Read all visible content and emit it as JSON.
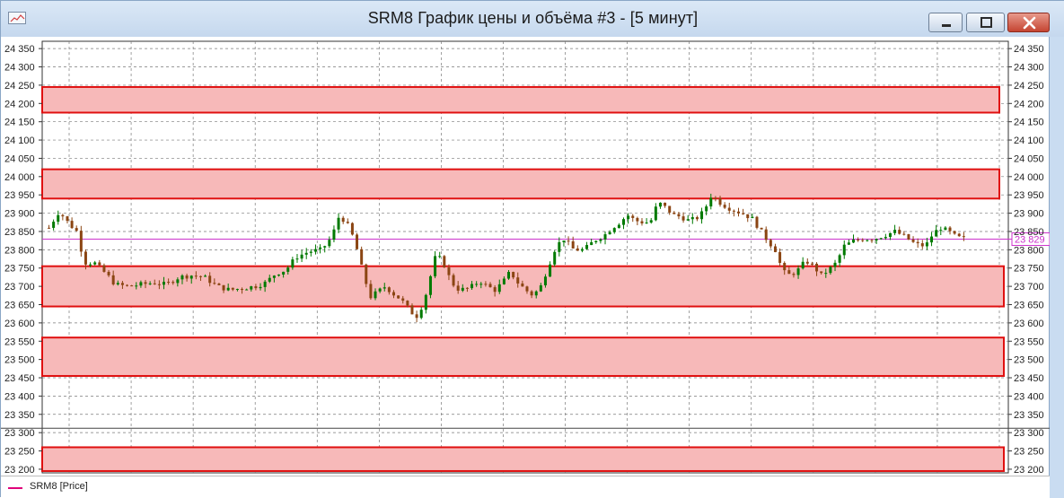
{
  "window": {
    "title": "SRM8 График цены и объёма #3 - [5 минут]",
    "controls": [
      "minimize",
      "maximize",
      "close"
    ]
  },
  "legend": {
    "label": "SRM8 [Price]",
    "color": "#e0007a"
  },
  "colors": {
    "up_candle": "#007a00",
    "down_candle": "#8b4513",
    "zone_fill": "#f7b9b9",
    "zone_border": "#e01010",
    "last_price_line": "#cc33cc",
    "grid": "#7a7a7a"
  },
  "chart_data": {
    "type": "candlestick",
    "title": "",
    "xlabel": "",
    "ylabel": "",
    "ylim": [
      23190,
      24370
    ],
    "y_ticks": [
      "24 350",
      "24 300",
      "24 250",
      "24 200",
      "24 150",
      "24 100",
      "24 050",
      "24 000",
      "23 950",
      "23 900",
      "23 850",
      "23 800",
      "23 750",
      "23 700",
      "23 650",
      "23 600",
      "23 550",
      "23 500",
      "23 450",
      "23 400",
      "23 350",
      "23 300",
      "23 250",
      "23 200"
    ],
    "y_tick_values": [
      24350,
      24300,
      24250,
      24200,
      24150,
      24100,
      24050,
      24000,
      23950,
      23900,
      23850,
      23800,
      23750,
      23700,
      23650,
      23600,
      23550,
      23500,
      23450,
      23400,
      23350,
      23300,
      23250,
      23200
    ],
    "last_price": 23829,
    "last_price_label": "23 829",
    "grid": true,
    "zones": [
      {
        "low": 24175,
        "high": 24245,
        "name": "zone-1"
      },
      {
        "low": 23940,
        "high": 24020,
        "name": "zone-2"
      },
      {
        "low": 23645,
        "high": 23755,
        "name": "zone-3"
      },
      {
        "low": 23455,
        "high": 23560,
        "name": "zone-4"
      },
      {
        "low": 23195,
        "high": 23260,
        "name": "zone-5"
      }
    ],
    "path_points": [
      [
        0,
        23860
      ],
      [
        8,
        23905
      ],
      [
        16,
        23870
      ],
      [
        22,
        23850
      ],
      [
        26,
        23790
      ],
      [
        30,
        23755
      ],
      [
        34,
        23770
      ],
      [
        40,
        23750
      ],
      [
        46,
        23730
      ],
      [
        52,
        23705
      ],
      [
        62,
        23700
      ],
      [
        72,
        23705
      ],
      [
        82,
        23710
      ],
      [
        92,
        23705
      ],
      [
        102,
        23725
      ],
      [
        112,
        23730
      ],
      [
        122,
        23725
      ],
      [
        132,
        23700
      ],
      [
        142,
        23690
      ],
      [
        152,
        23695
      ],
      [
        162,
        23700
      ],
      [
        170,
        23710
      ],
      [
        178,
        23735
      ],
      [
        186,
        23745
      ],
      [
        194,
        23780
      ],
      [
        204,
        23795
      ],
      [
        214,
        23800
      ],
      [
        222,
        23835
      ],
      [
        228,
        23895
      ],
      [
        234,
        23870
      ],
      [
        240,
        23825
      ],
      [
        244,
        23770
      ],
      [
        248,
        23720
      ],
      [
        252,
        23670
      ],
      [
        258,
        23685
      ],
      [
        264,
        23700
      ],
      [
        270,
        23680
      ],
      [
        276,
        23665
      ],
      [
        282,
        23640
      ],
      [
        288,
        23615
      ],
      [
        292,
        23640
      ],
      [
        296,
        23680
      ],
      [
        300,
        23735
      ],
      [
        304,
        23790
      ],
      [
        310,
        23760
      ],
      [
        316,
        23710
      ],
      [
        322,
        23690
      ],
      [
        330,
        23695
      ],
      [
        338,
        23715
      ],
      [
        344,
        23700
      ],
      [
        350,
        23690
      ],
      [
        356,
        23710
      ],
      [
        362,
        23740
      ],
      [
        368,
        23710
      ],
      [
        374,
        23690
      ],
      [
        380,
        23675
      ],
      [
        386,
        23700
      ],
      [
        392,
        23755
      ],
      [
        398,
        23810
      ],
      [
        404,
        23830
      ],
      [
        412,
        23800
      ],
      [
        420,
        23800
      ],
      [
        428,
        23825
      ],
      [
        436,
        23840
      ],
      [
        442,
        23860
      ],
      [
        448,
        23875
      ],
      [
        454,
        23895
      ],
      [
        460,
        23880
      ],
      [
        466,
        23875
      ],
      [
        472,
        23875
      ],
      [
        478,
        23930
      ],
      [
        484,
        23915
      ],
      [
        490,
        23895
      ],
      [
        496,
        23890
      ],
      [
        502,
        23880
      ],
      [
        508,
        23885
      ],
      [
        514,
        23905
      ],
      [
        520,
        23950
      ],
      [
        528,
        23925
      ],
      [
        536,
        23910
      ],
      [
        544,
        23900
      ],
      [
        552,
        23885
      ],
      [
        558,
        23855
      ],
      [
        564,
        23825
      ],
      [
        570,
        23800
      ],
      [
        576,
        23740
      ],
      [
        582,
        23730
      ],
      [
        588,
        23745
      ],
      [
        594,
        23770
      ],
      [
        600,
        23755
      ],
      [
        606,
        23730
      ],
      [
        612,
        23745
      ],
      [
        618,
        23765
      ],
      [
        624,
        23810
      ],
      [
        632,
        23825
      ],
      [
        640,
        23830
      ],
      [
        648,
        23830
      ],
      [
        656,
        23840
      ],
      [
        664,
        23850
      ],
      [
        672,
        23835
      ],
      [
        680,
        23815
      ],
      [
        688,
        23810
      ],
      [
        694,
        23845
      ],
      [
        700,
        23860
      ],
      [
        706,
        23850
      ],
      [
        712,
        23835
      ],
      [
        718,
        23830
      ]
    ],
    "x_gridlines": 16,
    "series": [
      {
        "name": "SRM8 [Price]"
      }
    ]
  }
}
